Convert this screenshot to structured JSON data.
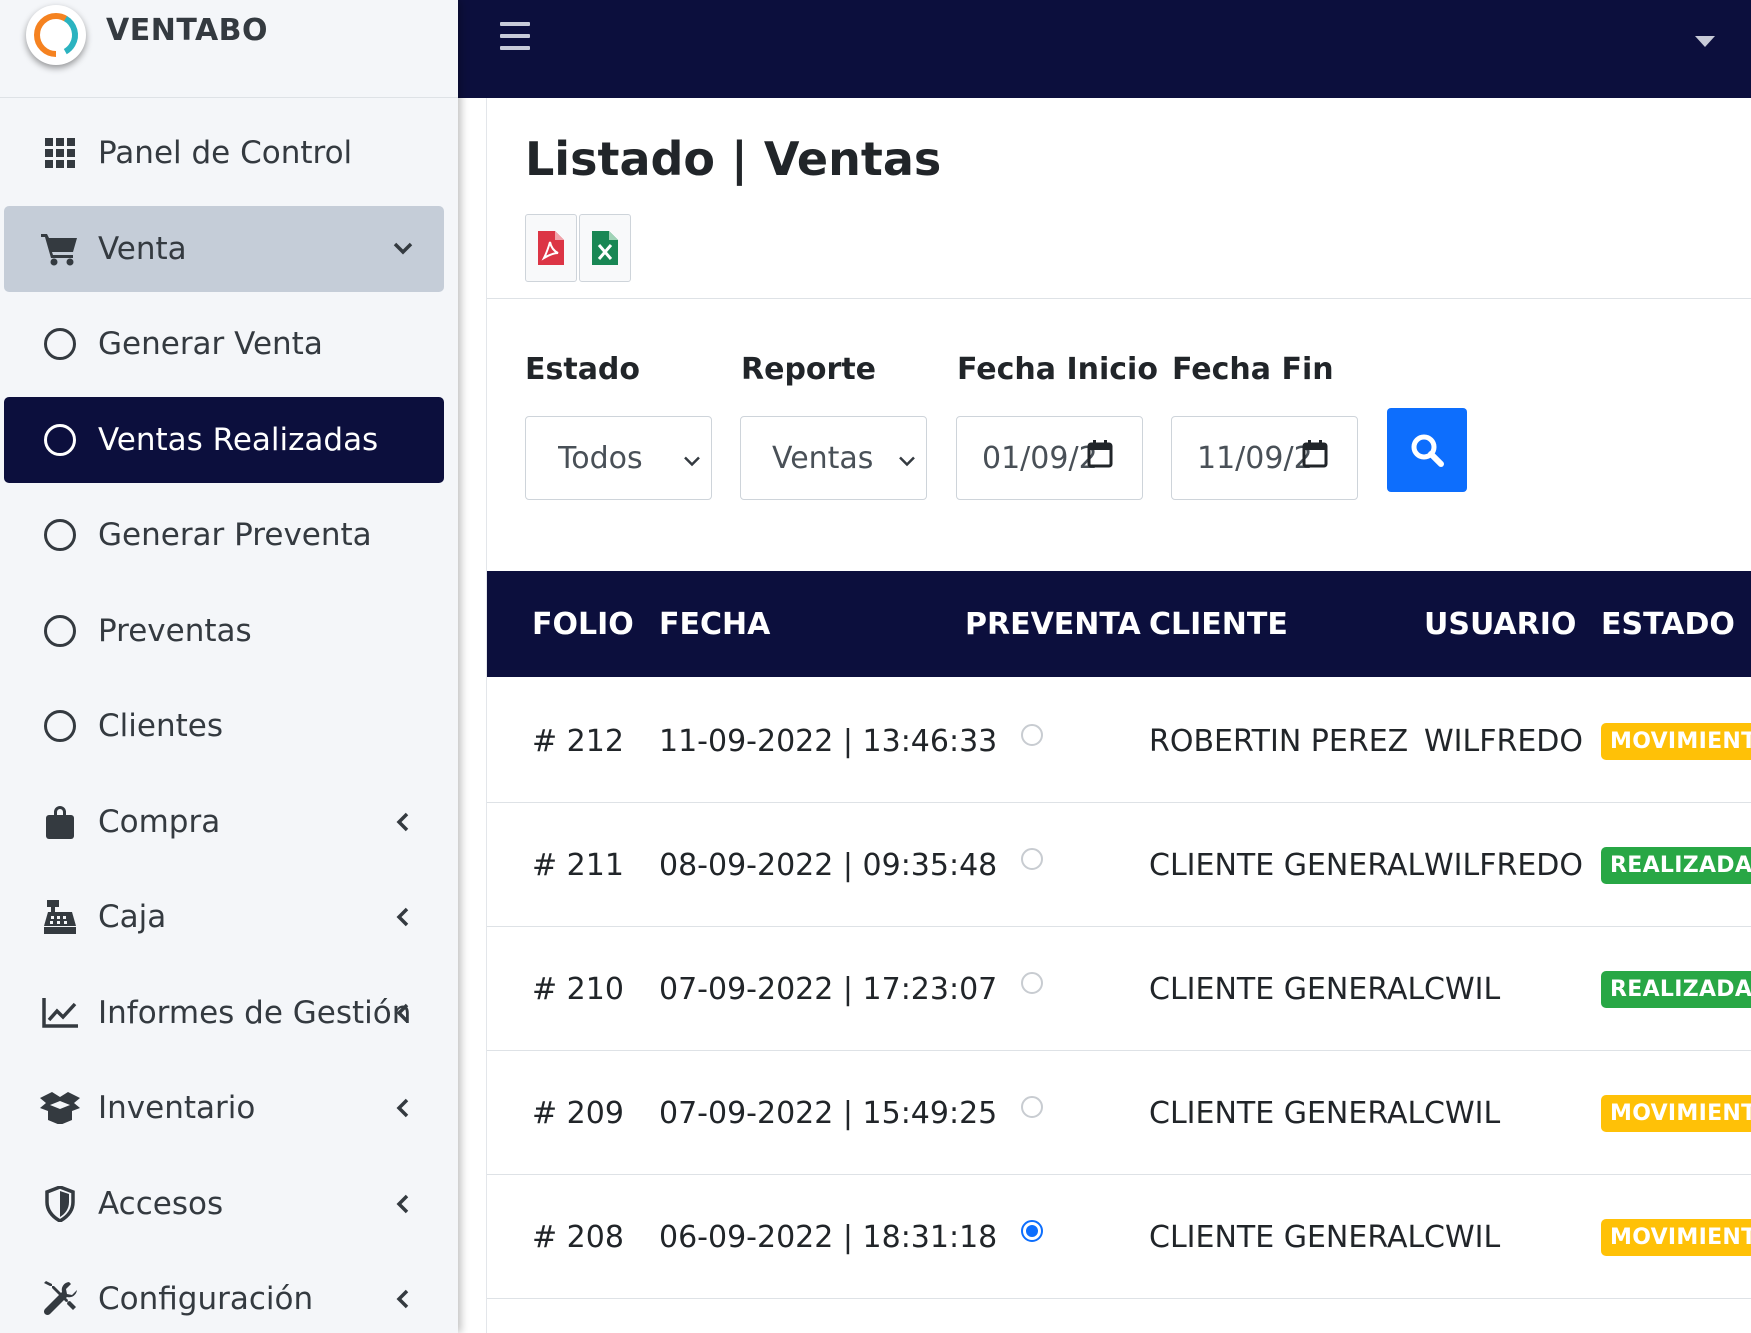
{
  "brand": {
    "name": "VENTABO"
  },
  "sidebar": {
    "items": [
      {
        "label": "Panel de Control",
        "icon": "grid-icon"
      },
      {
        "label": "Venta",
        "icon": "cart-icon",
        "arrow": "chevron-down-icon",
        "state": "open"
      },
      {
        "label": "Generar Venta",
        "icon": "circle-icon"
      },
      {
        "label": "Ventas Realizadas",
        "icon": "circle-icon",
        "state": "active"
      },
      {
        "label": "Generar Preventa",
        "icon": "circle-icon"
      },
      {
        "label": "Preventas",
        "icon": "circle-icon"
      },
      {
        "label": "Clientes",
        "icon": "circle-icon"
      },
      {
        "label": "Compra",
        "icon": "shopping-bag-icon",
        "arrow": "chevron-left-icon"
      },
      {
        "label": "Caja",
        "icon": "cash-register-icon",
        "arrow": "chevron-left-icon"
      },
      {
        "label": "Informes de Gestión",
        "icon": "chart-line-icon",
        "arrow": "chevron-left-icon"
      },
      {
        "label": "Inventario",
        "icon": "box-open-icon",
        "arrow": "chevron-left-icon"
      },
      {
        "label": "Accesos",
        "icon": "shield-icon",
        "arrow": "chevron-left-icon"
      },
      {
        "label": "Configuración",
        "icon": "tools-icon",
        "arrow": "chevron-left-icon"
      }
    ]
  },
  "page": {
    "title": "Listado | Ventas"
  },
  "filters": {
    "estado": {
      "label": "Estado",
      "value": "Todos"
    },
    "reporte": {
      "label": "Reporte",
      "value": "Ventas p"
    },
    "fecha_inicio": {
      "label": "Fecha Inicio",
      "value": "01/09/2"
    },
    "fecha_fin": {
      "label": "Fecha Fin",
      "value": "11/09/2"
    }
  },
  "table": {
    "headers": [
      "FOLIO",
      "FECHA",
      "PREVENTA",
      "CLIENTE",
      "USUARIO",
      "ESTADO"
    ],
    "rows": [
      {
        "folio": "# 212",
        "fecha": "11-09-2022 | 13:46:33",
        "preventa": false,
        "cliente": "ROBERTIN PEREZ",
        "usuario": "WILFREDO",
        "estado": "MOVIMIENTO"
      },
      {
        "folio": "# 211",
        "fecha": "08-09-2022 | 09:35:48",
        "preventa": false,
        "cliente": "CLIENTE GENERAL",
        "usuario": "WILFREDO",
        "estado": "REALIZADA"
      },
      {
        "folio": "# 210",
        "fecha": "07-09-2022 | 17:23:07",
        "preventa": false,
        "cliente": "CLIENTE GENERAL",
        "usuario": "CWIL",
        "estado": "REALIZADA"
      },
      {
        "folio": "# 209",
        "fecha": "07-09-2022 | 15:49:25",
        "preventa": false,
        "cliente": "CLIENTE GENERAL",
        "usuario": "CWIL",
        "estado": "MOVIMIENTO"
      },
      {
        "folio": "# 208",
        "fecha": "06-09-2022 | 18:31:18",
        "preventa": true,
        "cliente": "CLIENTE GENERAL",
        "usuario": "CWIL",
        "estado": "MOVIMIENTO"
      }
    ]
  },
  "colors": {
    "navy": "#0c0f3d",
    "primary": "#0d6efd",
    "movimiento": "#ffc107",
    "realizada": "#28a745",
    "pdf": "#dc3545",
    "excel": "#198754"
  }
}
